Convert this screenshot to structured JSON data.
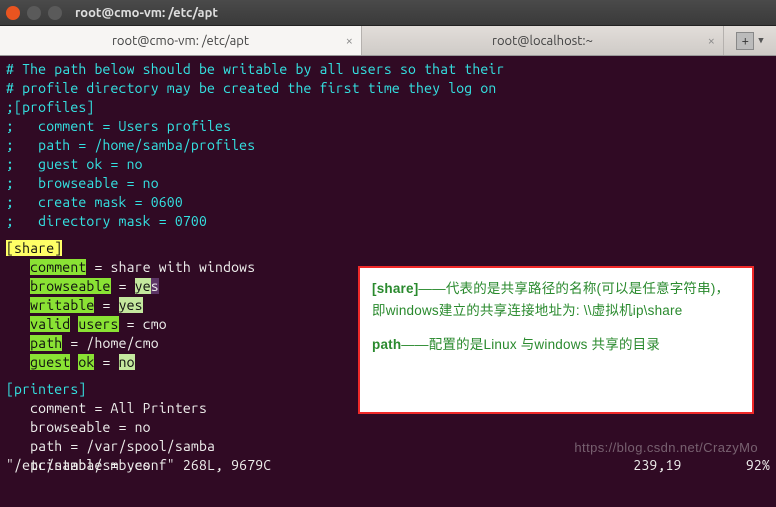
{
  "window": {
    "title": "root@cmo-vm: /etc/apt"
  },
  "tabs": {
    "active": "root@cmo-vm: /etc/apt",
    "inactive": "root@localhost:~"
  },
  "code": {
    "l1": "# The path below should be writable by all users so that their",
    "l2": "# profile directory may be created the first time they log on",
    "l3": ";[profiles]",
    "l4": ";   comment = Users profiles",
    "l5": ";   path = /home/samba/profiles",
    "l6": ";   guest ok = no",
    "l7": ";   browseable = no",
    "l8": ";   create mask = 0600",
    "l9": ";   directory mask = 0700"
  },
  "share": {
    "h_open": "[",
    "h_label": "share",
    "h_close": "]",
    "pad": "   ",
    "comment_key": "comment",
    "eq": " = ",
    "comment_val": "share with windows",
    "brow_key": "browseable",
    "brow_val_a": "ye",
    "brow_val_b": "s",
    "writ_key": "writable",
    "writ_val": "yes",
    "valid_a": "valid",
    "valid_sp": " ",
    "valid_b": "users",
    "valid_val": "cmo",
    "path_key": "path",
    "path_val": "/home/cmo",
    "guest_a": "guest",
    "guest_sp": " ",
    "guest_b": "ok",
    "guest_val": "no"
  },
  "printers": {
    "h": "[printers]",
    "pad": "   ",
    "c1": "comment = All Printers",
    "c2": "browseable = no",
    "c3": "path = /var/spool/samba",
    "c4": "printable = yes"
  },
  "note": {
    "t1a": "[share]",
    "t1b": "——代表的是共享路径的名称(可以是任意字符串)，即windows建立的共享连接地址为: \\\\虚拟机ip\\share",
    "t2a": "path",
    "t2b": "——配置的是Linux 与windows 共享的目录"
  },
  "status": {
    "left": "\"/etc/samba/smb.conf\" 268L, 9679C",
    "right": "239,19        92%"
  },
  "watermark": "https://blog.csdn.net/CrazyMo"
}
